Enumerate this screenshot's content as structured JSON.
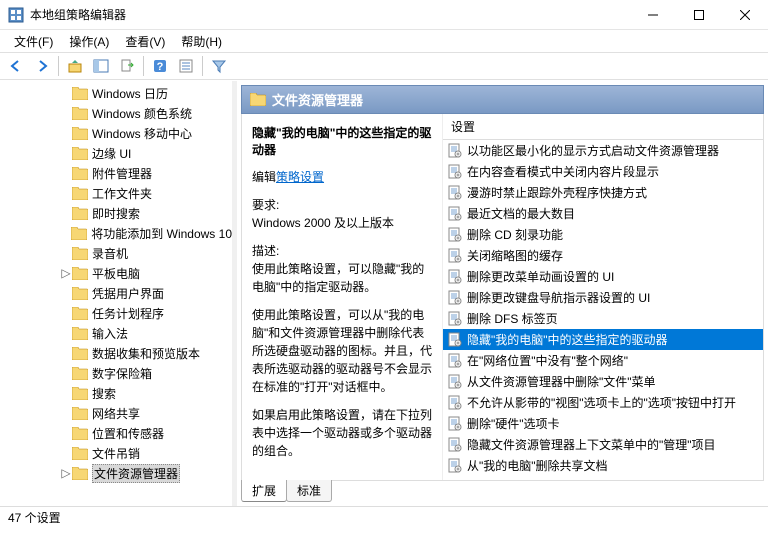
{
  "window": {
    "title": "本地组策略编辑器"
  },
  "menu": {
    "file": "文件(F)",
    "action": "操作(A)",
    "view": "查看(V)",
    "help": "帮助(H)"
  },
  "tree": {
    "items": [
      {
        "label": "Windows 日历"
      },
      {
        "label": "Windows 颜色系统"
      },
      {
        "label": "Windows 移动中心"
      },
      {
        "label": "边缘 UI"
      },
      {
        "label": "附件管理器"
      },
      {
        "label": "工作文件夹"
      },
      {
        "label": "即时搜索"
      },
      {
        "label": "将功能添加到 Windows 10"
      },
      {
        "label": "录音机"
      },
      {
        "label": "平板电脑",
        "expandable": true
      },
      {
        "label": "凭据用户界面"
      },
      {
        "label": "任务计划程序"
      },
      {
        "label": "输入法"
      },
      {
        "label": "数据收集和预览版本"
      },
      {
        "label": "数字保险箱"
      },
      {
        "label": "搜索"
      },
      {
        "label": "网络共享"
      },
      {
        "label": "位置和传感器"
      },
      {
        "label": "文件吊销"
      },
      {
        "label": "文件资源管理器",
        "expandable": true,
        "selected": true
      }
    ]
  },
  "header": {
    "title": "文件资源管理器"
  },
  "detail": {
    "title": "隐藏\"我的电脑\"中的这些指定的驱动器",
    "edit_prefix": "编辑",
    "edit_link": "策略设置",
    "req_label": "要求:",
    "req_value": "Windows 2000 及以上版本",
    "desc_label": "描述:",
    "desc1": "使用此策略设置，可以隐藏\"我的电脑\"中的指定驱动器。",
    "desc2": "使用此策略设置，可以从\"我的电脑\"和文件资源管理器中删除代表所选硬盘驱动器的图标。并且，代表所选驱动器的驱动器号不会显示在标准的\"打开\"对话框中。",
    "desc3": "如果启用此策略设置，请在下拉列表中选择一个驱动器或多个驱动器的组合。"
  },
  "list": {
    "header": "设置",
    "items": [
      "以功能区最小化的显示方式启动文件资源管理器",
      "在内容查看模式中关闭内容片段显示",
      "漫游时禁止跟踪外壳程序快捷方式",
      "最近文档的最大数目",
      "删除 CD 刻录功能",
      "关闭缩略图的缓存",
      "删除更改菜单动画设置的 UI",
      "删除更改键盘导航指示器设置的 UI",
      "删除 DFS 标签页",
      "隐藏\"我的电脑\"中的这些指定的驱动器",
      "在\"网络位置\"中没有\"整个网络\"",
      "从文件资源管理器中删除\"文件\"菜单",
      "不允许从影带的\"视图\"选项卡上的\"选项\"按钮中打开",
      "删除\"硬件\"选项卡",
      "隐藏文件资源管理器上下文菜单中的\"管理\"项目",
      "从\"我的电脑\"删除共享文档"
    ],
    "selected_index": 9
  },
  "tabs": {
    "extended": "扩展",
    "standard": "标准"
  },
  "status": {
    "text": "47 个设置"
  }
}
